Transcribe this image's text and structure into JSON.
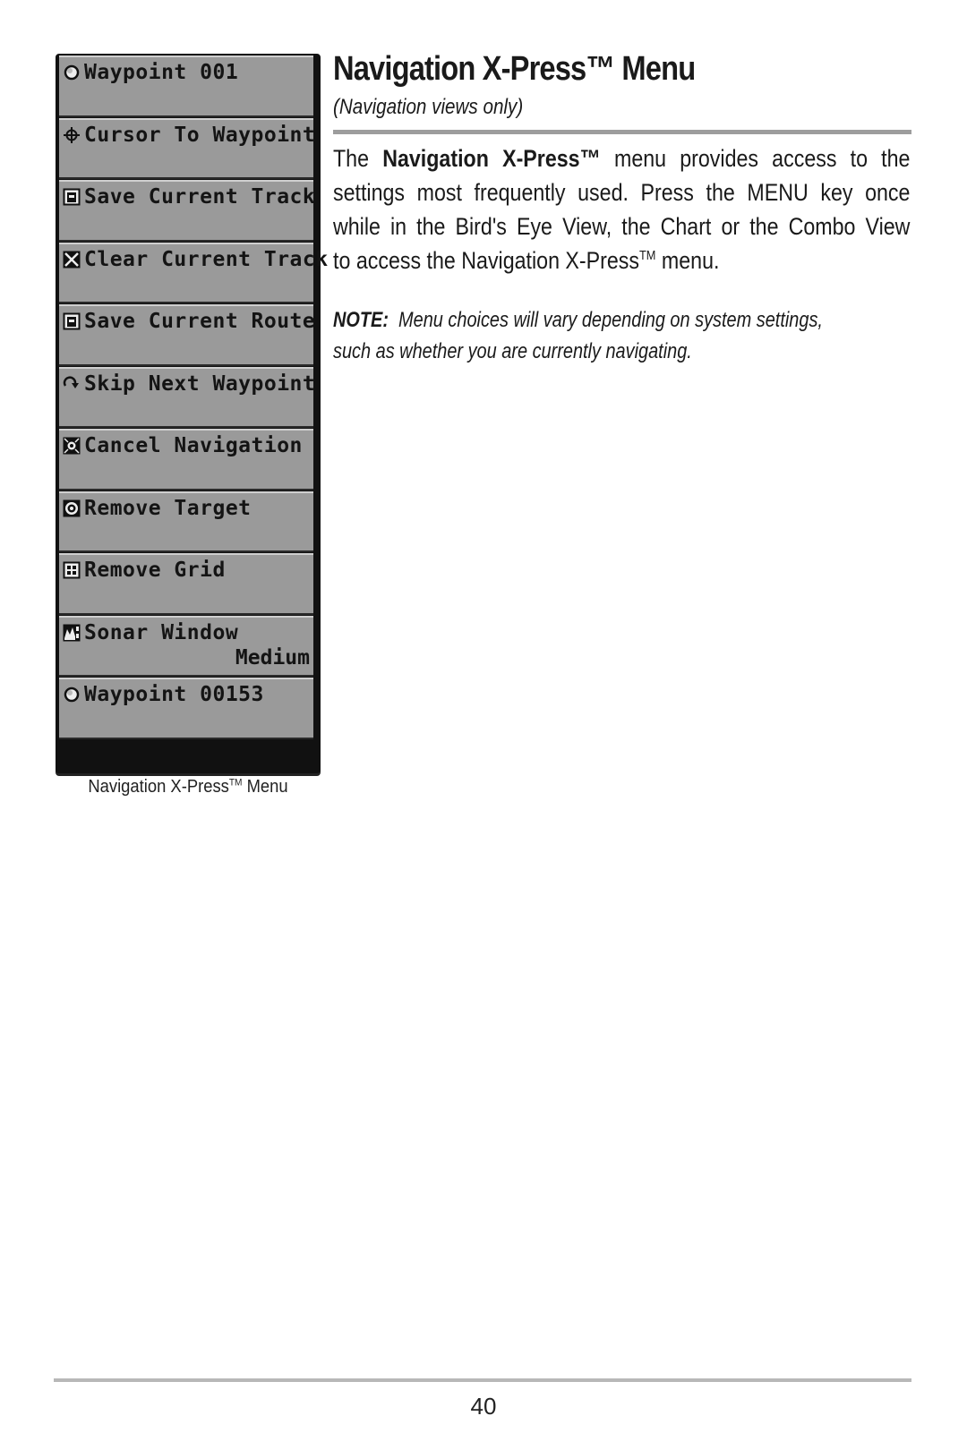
{
  "menu": {
    "items": [
      {
        "icon": "waypoint-icon",
        "label": "Waypoint 001",
        "value": ""
      },
      {
        "icon": "crosshair-icon",
        "label": "Cursor To Waypoint",
        "value": ""
      },
      {
        "icon": "save-icon",
        "label": "Save Current Track",
        "value": ""
      },
      {
        "icon": "clear-icon",
        "label": "Clear Current Track",
        "value": ""
      },
      {
        "icon": "save-icon",
        "label": "Save Current Route",
        "value": ""
      },
      {
        "icon": "skip-icon",
        "label": "Skip Next Waypoint",
        "value": ""
      },
      {
        "icon": "cancel-navigation-icon",
        "label": "Cancel Navigation",
        "value": ""
      },
      {
        "icon": "target-icon",
        "label": "Remove Target",
        "value": ""
      },
      {
        "icon": "grid-icon",
        "label": "Remove Grid",
        "value": ""
      },
      {
        "icon": "sonar-window-icon",
        "label": "Sonar Window",
        "value": "Medium"
      },
      {
        "icon": "waypoint-icon",
        "label": "Waypoint 00153",
        "value": ""
      }
    ]
  },
  "caption": {
    "text": "Navigation X-Press",
    "tm": "TM",
    "suffix": " Menu"
  },
  "heading": {
    "title": "Navigation X-Press",
    "tm": "™",
    "title_suffix": " Menu",
    "subtitle": "(Navigation views only)"
  },
  "body": {
    "lines": [
      {
        "pre": "The ",
        "bold": "Navigation X-Press™",
        "post": " menu provides access to the"
      },
      {
        "text": "settings most frequently used.  Press the MENU key once"
      },
      {
        "text": "while in the Bird's Eye View, the Chart or the Combo View"
      },
      {
        "pre": "to access the Navigation X-Press",
        "sup": "TM",
        "post": " menu."
      }
    ]
  },
  "note": {
    "label": "NOTE:",
    "line1": "  Menu choices will vary depending on system settings,",
    "line2": "such as whether you are currently navigating."
  },
  "footer": {
    "page_number": "40"
  }
}
